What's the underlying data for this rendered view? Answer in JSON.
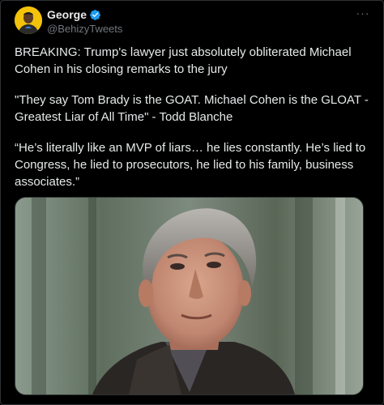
{
  "tweet": {
    "author": {
      "display_name": "George",
      "handle": "@BehizyTweets",
      "verified": true,
      "verified_color": "#1d9bf0",
      "avatar_icon": "avatar-photo"
    },
    "more_label": "···",
    "paragraphs": [
      "BREAKING: Trump's lawyer just absolutely obliterated Michael Cohen in his closing remarks to the jury",
      "\"They say Tom Brady is the GOAT. Michael Cohen is the GLOAT - Greatest Liar of All Time\" - Todd Blanche",
      "“He’s literally like an MVP of liars… he lies constantly. He’s lied to Congress, he lied to prosecutors, he lied to his family, business associates.”"
    ],
    "media": {
      "type": "photo",
      "icon": "portrait-photo"
    }
  },
  "colors": {
    "background": "#000000",
    "text": "#e7e9ea",
    "secondary": "#71767b",
    "border": "#2f3336"
  }
}
